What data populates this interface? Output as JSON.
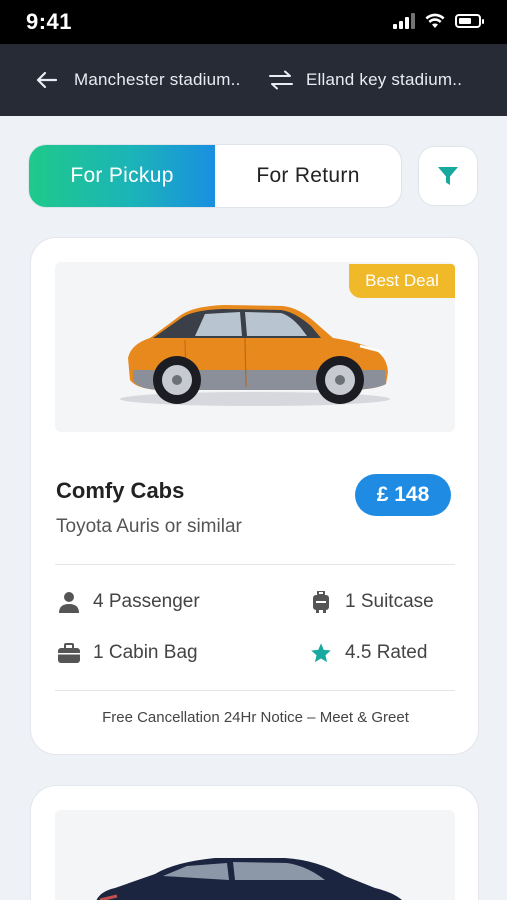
{
  "status": {
    "time": "9:41"
  },
  "route": {
    "from": "Manchester stadium..",
    "to": "Elland key stadium.."
  },
  "toggle": {
    "pickup": "For Pickup",
    "return": "For Return",
    "active": "pickup"
  },
  "listings": [
    {
      "badge": "Best Deal",
      "company": "Comfy Cabs",
      "model": "Toyota Auris or similar",
      "price": "£ 148",
      "features": {
        "passengers": "4 Passenger",
        "suitcase": "1 Suitcase",
        "cabin_bag": "1 Cabin Bag",
        "rating": "4.5 Rated"
      },
      "notice": "Free Cancellation 24Hr Notice – Meet & Greet",
      "car_color": "#e8891e"
    },
    {
      "car_color": "#1c2540"
    }
  ],
  "colors": {
    "accent_blue": "#1f8be2",
    "accent_green": "#1fc98a",
    "badge_yellow": "#f0b92a",
    "icon_teal": "#18a99e",
    "header_bg": "#262b36"
  }
}
